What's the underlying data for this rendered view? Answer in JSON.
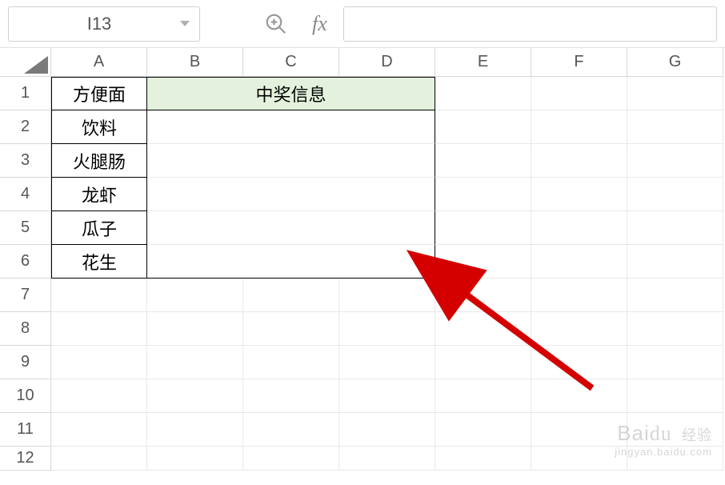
{
  "formula_bar": {
    "cell_ref": "I13",
    "fx_label": "fx",
    "formula_value": ""
  },
  "columns": [
    "A",
    "B",
    "C",
    "D",
    "E",
    "F",
    "G"
  ],
  "rows": [
    "1",
    "2",
    "3",
    "4",
    "5",
    "6",
    "7",
    "8",
    "9",
    "10",
    "11",
    "12"
  ],
  "cells": {
    "A1": "方便面",
    "A2": "饮料",
    "A3": "火腿肠",
    "A4": "龙虾",
    "A5": "瓜子",
    "A6": "花生",
    "merged_B1D1": "中奖信息"
  },
  "watermark": {
    "line1_brand": "Bai",
    "line1_brand2": "经验",
    "line2": "jingyan.baidu.com"
  }
}
